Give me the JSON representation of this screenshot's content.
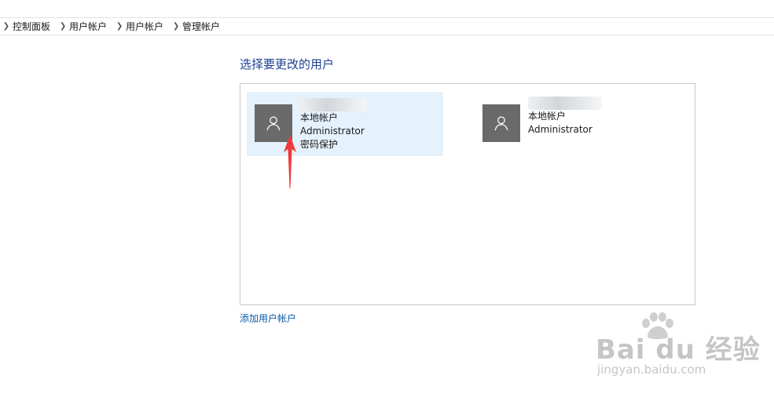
{
  "breadcrumb": {
    "items": [
      {
        "label": "控制面板"
      },
      {
        "label": "用户帐户"
      },
      {
        "label": "用户帐户"
      },
      {
        "label": "管理帐户"
      }
    ]
  },
  "page": {
    "title": "选择要更改的用户"
  },
  "users": [
    {
      "name": "",
      "type": "本地帐户",
      "role": "Administrator",
      "protection": "密码保护",
      "selected": true
    },
    {
      "name": "",
      "type": "本地帐户",
      "role": "Administrator",
      "selected": false
    }
  ],
  "actions": {
    "add_user_label": "添加用户帐户"
  },
  "watermark": {
    "logo_text": "Bai du 经验",
    "url_text": "jingyan.baidu.com"
  },
  "icons": {
    "breadcrumb_separator": "chevron-right-icon",
    "avatar": "user-icon",
    "annotation": "arrow-up-icon"
  },
  "colors": {
    "title": "#1e3e93",
    "link": "#0c5aa6",
    "selected_tile": "#e5f1fb",
    "avatar_bg": "#6a6a6a",
    "annotation_arrow": "#f03a3a"
  }
}
